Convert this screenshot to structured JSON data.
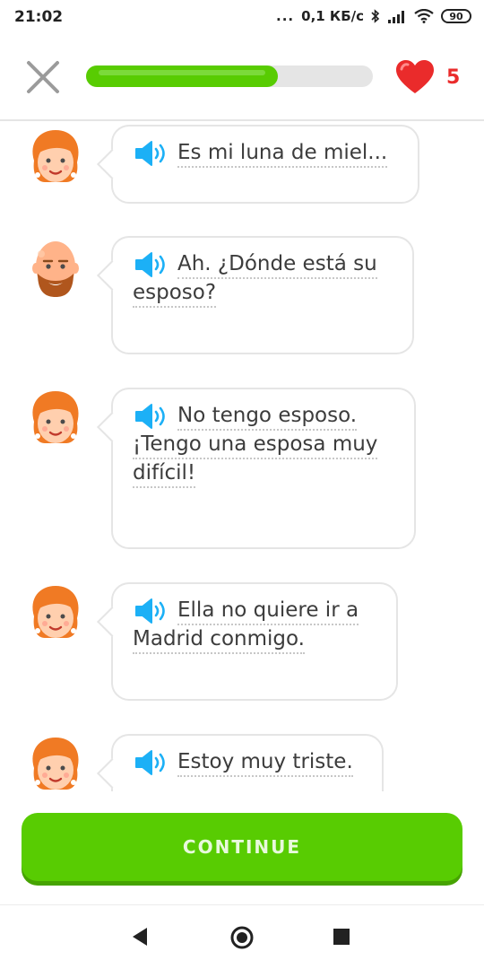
{
  "status_bar": {
    "time": "21:02",
    "dots": "...",
    "network_speed": "0,1 КБ/с",
    "battery": "90"
  },
  "lesson": {
    "progress": 0.67,
    "hearts": "5",
    "accent_color": "#58cc02",
    "heart_color": "#ea2b2b"
  },
  "messages": [
    {
      "speaker": "woman",
      "lines": [
        "Es mi luna de miel..."
      ]
    },
    {
      "speaker": "man",
      "lines": [
        "Ah. ¿Dónde está su",
        "esposo?"
      ]
    },
    {
      "speaker": "woman",
      "lines": [
        "No tengo esposo.",
        "¡Tengo una esposa muy",
        "difícil!"
      ]
    },
    {
      "speaker": "woman",
      "lines": [
        "Ella no quiere ir a",
        "Madrid conmigo."
      ]
    },
    {
      "speaker": "woman",
      "lines": [
        "Estoy muy triste."
      ]
    }
  ],
  "continue_button": {
    "label": "CONTINUE"
  },
  "nav": {
    "icons": [
      "back-icon",
      "home-icon",
      "recents-icon"
    ]
  }
}
